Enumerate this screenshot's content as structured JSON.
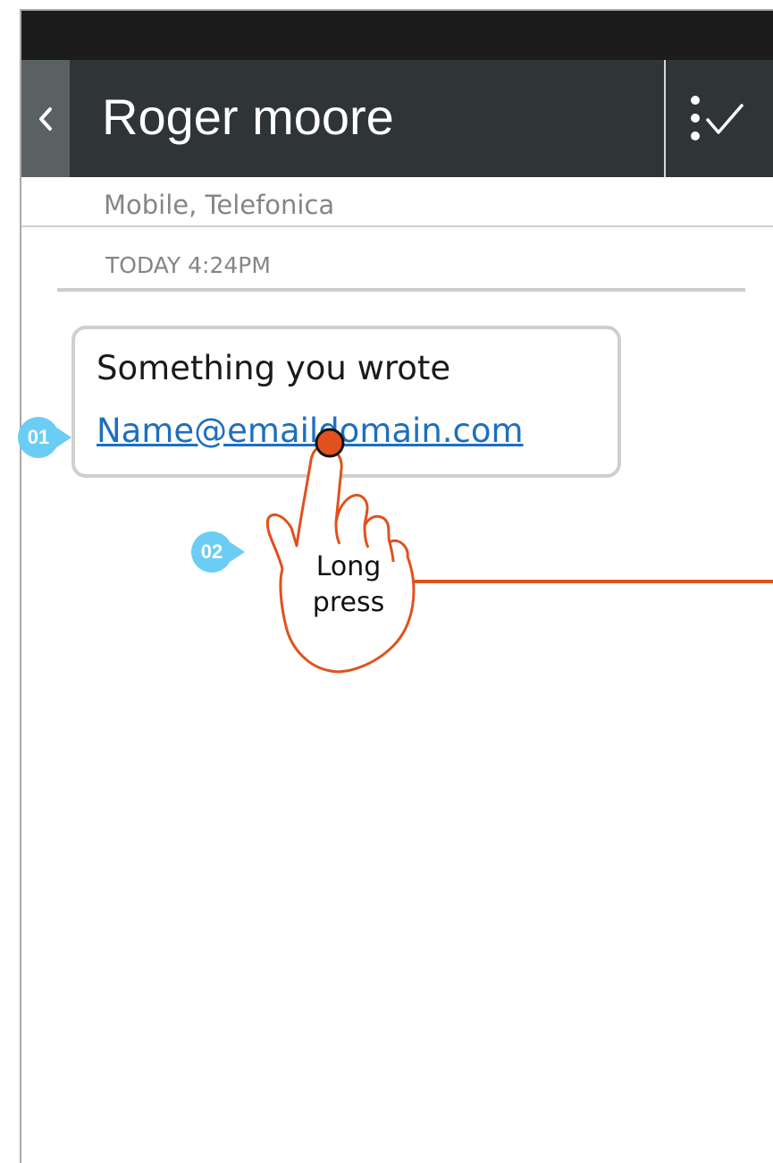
{
  "status_bar": {},
  "header": {
    "back_icon": "chevron-left-icon",
    "title": "Roger moore",
    "action_icon": "select-checkmark-icon"
  },
  "subheader": {
    "text": "Mobile, Telefonica"
  },
  "thread": {
    "date_separator": "TODAY 4:24PM",
    "messages": [
      {
        "text": "Something you wrote",
        "link": "Name@emaildomain.com"
      }
    ]
  },
  "annotations": {
    "markers": [
      "01",
      "02"
    ],
    "gesture_label_line1": "Long",
    "gesture_label_line2": "press",
    "gesture_icon": "hand-pointer-icon"
  },
  "colors": {
    "header_bg": "#2f3536",
    "status_bar_bg": "#1c1c1c",
    "back_button_bg": "#5a6162",
    "link": "#1d6fc0",
    "marker": "#6ccdf4",
    "gesture": "#e0511e"
  }
}
